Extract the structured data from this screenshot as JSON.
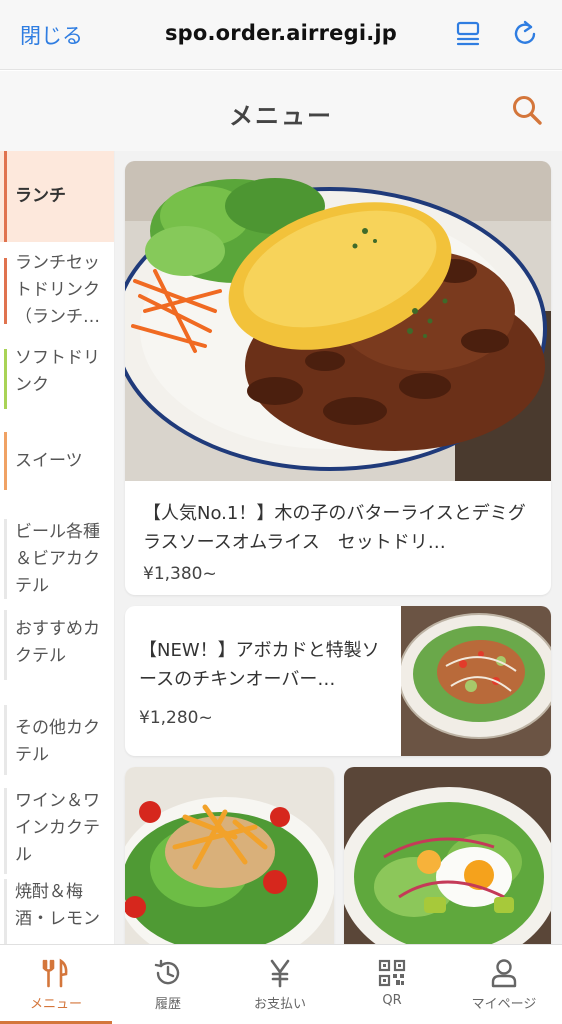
{
  "browser": {
    "close_label": "閉じる",
    "url": "spo.order.airregi.jp",
    "list_icon": "list-icon",
    "reload_icon": "reload-icon",
    "accent": "#2f7de1"
  },
  "header": {
    "title": "メニュー",
    "search_icon": "search-icon",
    "accent": "#d4763b"
  },
  "sidebar": {
    "items": [
      {
        "label": "ランチ",
        "active": true,
        "color": "#e0734f"
      },
      {
        "label": "ランチセットドリンク（ランチ…",
        "active": false,
        "color": "#e0734f"
      },
      {
        "label": "ソフトドリンク",
        "active": false,
        "color": "#a9d356"
      },
      {
        "label": "スイーツ",
        "active": false,
        "color": "#f0a264"
      },
      {
        "label": "ビール各種＆ビアカクテル",
        "active": false,
        "color": "#e8e8e8"
      },
      {
        "label": "おすすめカクテル",
        "active": false,
        "color": "#e8e8e8"
      },
      {
        "label": "その他カクテル",
        "active": false,
        "color": "#e8e8e8"
      },
      {
        "label": "ワイン＆ワインカクテル",
        "active": false,
        "color": "#e8e8e8"
      },
      {
        "label": "焼酎＆梅酒・レモン",
        "active": false,
        "color": "#e8e8e8"
      }
    ]
  },
  "menu": {
    "items": [
      {
        "title": "【人気No.1！】木の子のバターライスとデミグラスソースオムライス　セットドリ…",
        "price": "¥1,380~"
      },
      {
        "title": "【NEW！】アボカドと特製ソースのチキンオーバー…",
        "price": "¥1,280~"
      }
    ]
  },
  "nav": {
    "tabs": [
      {
        "label": "メニュー",
        "icon": "fork-knife-icon",
        "active": true
      },
      {
        "label": "履歴",
        "icon": "history-icon",
        "active": false
      },
      {
        "label": "お支払い",
        "icon": "yen-icon",
        "active": false
      },
      {
        "label": "QR",
        "icon": "qr-code-icon",
        "active": false
      },
      {
        "label": "マイページ",
        "icon": "user-icon",
        "active": false
      }
    ]
  }
}
